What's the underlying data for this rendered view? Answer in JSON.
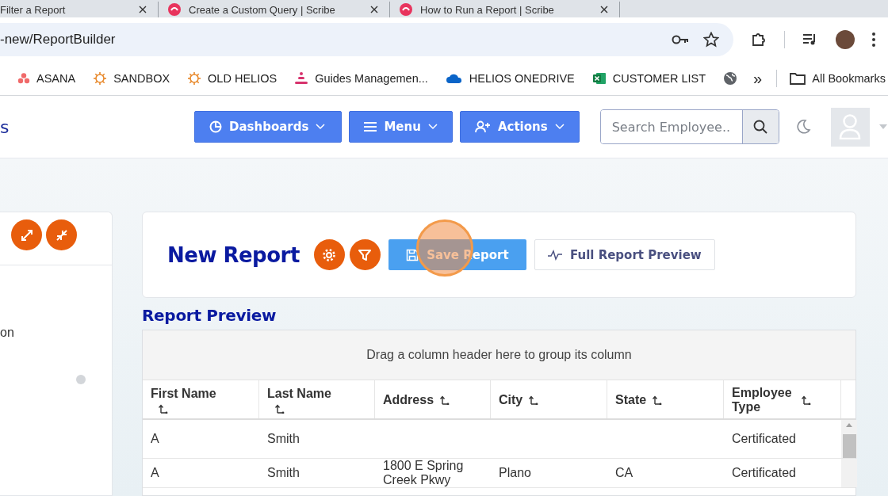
{
  "browser": {
    "tabs": [
      {
        "title": "Filter a Report",
        "kind": "plain"
      },
      {
        "title": "Create a Custom Query | Scribe",
        "kind": "scribe"
      },
      {
        "title": "How to Run a Report | Scribe",
        "kind": "scribe"
      }
    ],
    "address": "-new/ReportBuilder",
    "bookmarks": [
      {
        "label": "ASANA",
        "kind": "dots"
      },
      {
        "label": "SANDBOX",
        "kind": "sun"
      },
      {
        "label": "OLD HELIOS",
        "kind": "sun"
      },
      {
        "label": "Guides Managemen...",
        "kind": "stack"
      },
      {
        "label": "HELIOS ONEDRIVE",
        "kind": "cloud"
      },
      {
        "label": "CUSTOMER LIST",
        "kind": "sheet"
      },
      {
        "kind": "globe"
      }
    ],
    "overflow": "»",
    "all_bookmarks": "All Bookmarks"
  },
  "header": {
    "brand": "s",
    "nav": [
      {
        "label": "Dashboards",
        "kind": "pie"
      },
      {
        "label": "Menu",
        "kind": "bars"
      },
      {
        "label": "Actions",
        "kind": "user-plus"
      }
    ],
    "search": {
      "placeholder": "Search Employee.."
    }
  },
  "sidebar": {
    "text": "on"
  },
  "report": {
    "title": "New Report",
    "save": "Save Report",
    "preview": "Full Report Preview"
  },
  "preview": {
    "title": "Report Preview",
    "group_hint": "Drag a column header here to group its column",
    "columns": [
      "First Name",
      "Last Name",
      "Address",
      "City",
      "State",
      "Employee Type"
    ],
    "rows": [
      [
        "A",
        "Smith",
        "",
        "",
        "",
        "Certificated"
      ],
      [
        "A",
        "Smith",
        "1800 E Spring Creek Pkwy",
        "Plano",
        "CA",
        "Certificated"
      ]
    ]
  }
}
